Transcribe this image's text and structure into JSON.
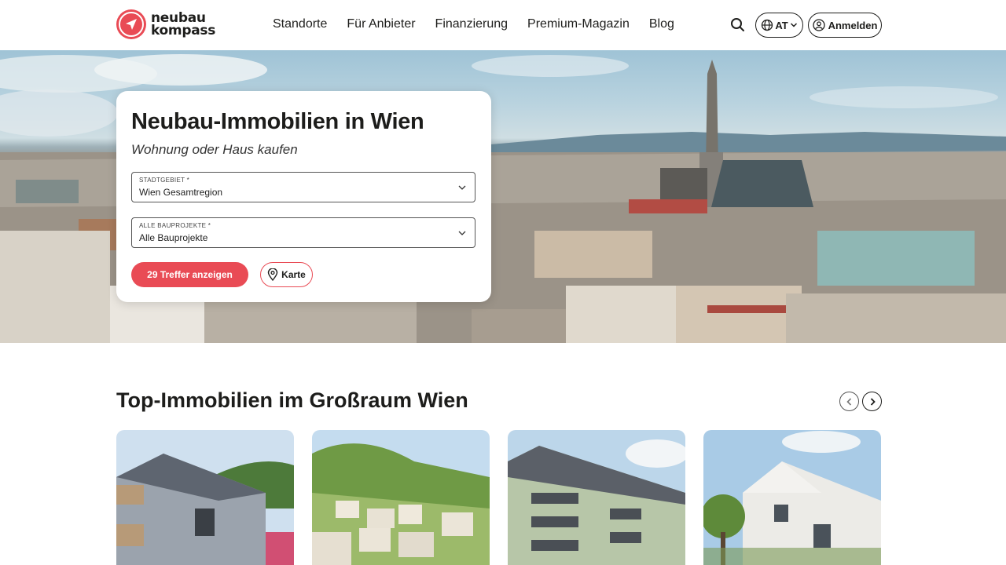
{
  "logo": {
    "line1": "neubau",
    "line2": "kompass"
  },
  "nav": [
    "Standorte",
    "Für Anbieter",
    "Finanzierung",
    "Premium-Magazin",
    "Blog"
  ],
  "header": {
    "lang": "AT",
    "login": "Anmelden"
  },
  "search": {
    "title": "Neubau-Immobilien in Wien",
    "subtitle": "Wohnung oder Haus kaufen",
    "region_label": "STADTGEBIET *",
    "region_value": "Wien Gesamtregion",
    "project_label": "ALLE BAUPROJEKTE *",
    "project_value": "Alle Bauprojekte",
    "submit": "29 Treffer anzeigen",
    "map": "Karte"
  },
  "section": {
    "title": "Top-Immobilien im Großraum Wien"
  },
  "colors": {
    "accent": "#e94b55",
    "text": "#1d1d1b"
  },
  "icons": [
    "search-icon",
    "globe-icon",
    "chevron-down-icon",
    "user-icon",
    "map-pin-icon",
    "chevron-left-icon",
    "chevron-right-icon"
  ]
}
